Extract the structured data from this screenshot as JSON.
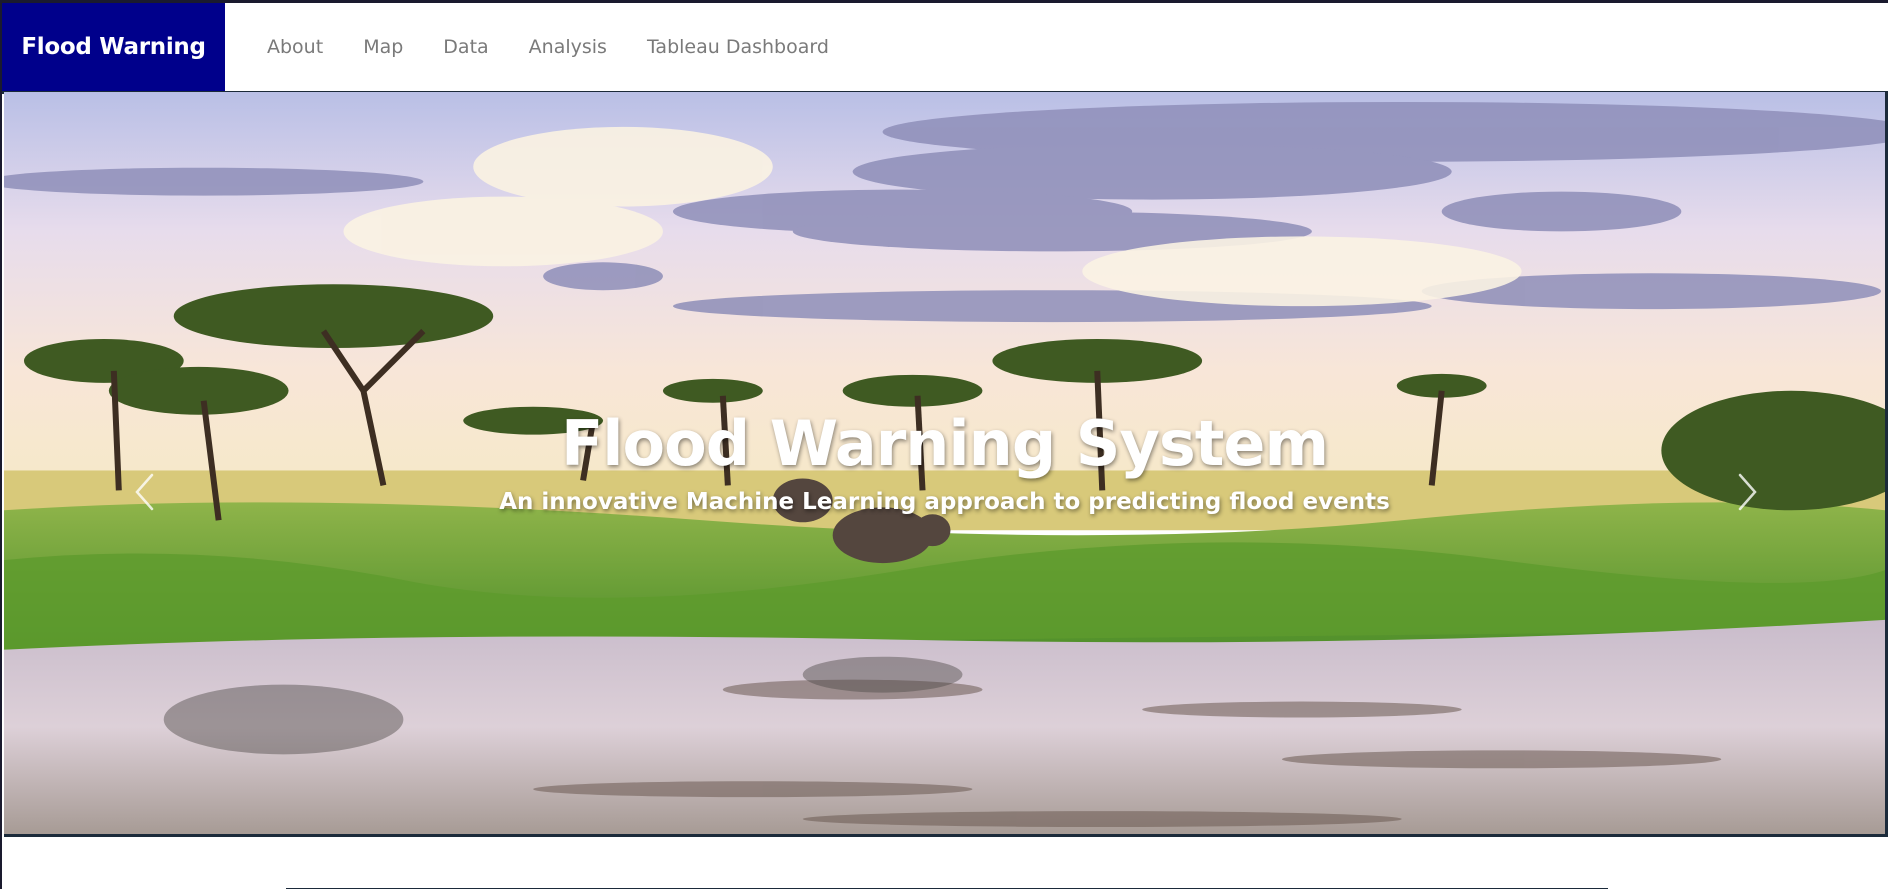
{
  "navbar": {
    "brand": "Flood Warning",
    "links": [
      {
        "label": "About"
      },
      {
        "label": "Map"
      },
      {
        "label": "Data"
      },
      {
        "label": "Analysis"
      },
      {
        "label": "Tableau Dashboard"
      }
    ]
  },
  "hero": {
    "title": "Flood Warning System",
    "subtitle": "An innovative Machine Learning approach to predicting flood events",
    "prev_icon": "chevron-left-icon",
    "next_icon": "chevron-right-icon"
  },
  "colors": {
    "brand_bg": "#00008b",
    "nav_text": "#7a7a7a",
    "border": "#1b2a3a"
  }
}
